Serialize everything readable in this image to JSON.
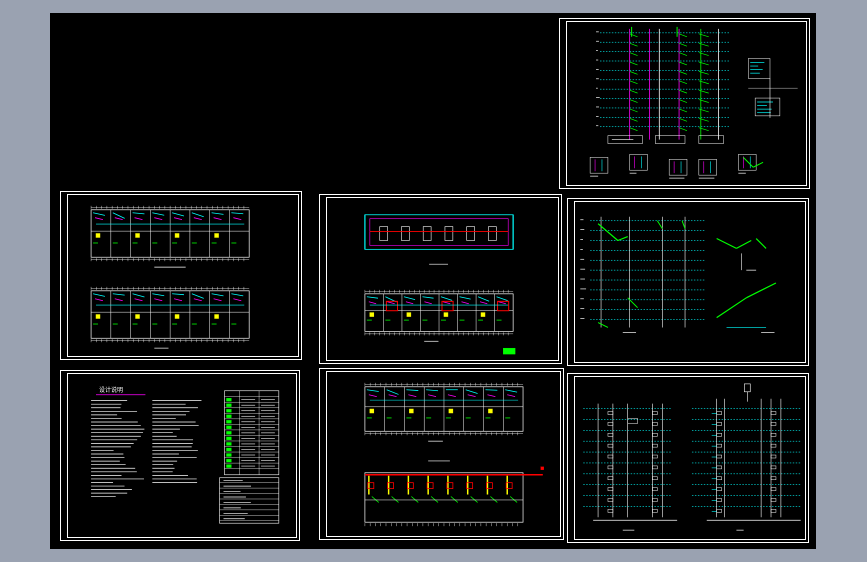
{
  "viewport": {
    "background": "#9aa2b1",
    "canvas_background": "#000000"
  },
  "colors": {
    "frame": "#ffffff",
    "cyan": "#00ffff",
    "yellow": "#ffff00",
    "green": "#00ff00",
    "magenta": "#ff00ff",
    "red": "#ff0000",
    "white": "#ffffff"
  },
  "sheets": [
    {
      "id": "sheet-riser-diagram-top",
      "kind": "riser"
    },
    {
      "id": "sheet-floor-plans-a",
      "kind": "plans"
    },
    {
      "id": "sheet-floor-plans-b",
      "kind": "plans"
    },
    {
      "id": "sheet-system-diagram",
      "kind": "system"
    },
    {
      "id": "sheet-design-notes",
      "kind": "notes"
    },
    {
      "id": "sheet-floor-plans-c",
      "kind": "plans"
    },
    {
      "id": "sheet-riser-diagram-bottom",
      "kind": "riser"
    }
  ],
  "notes_sheet": {
    "heading": "设计说明"
  }
}
